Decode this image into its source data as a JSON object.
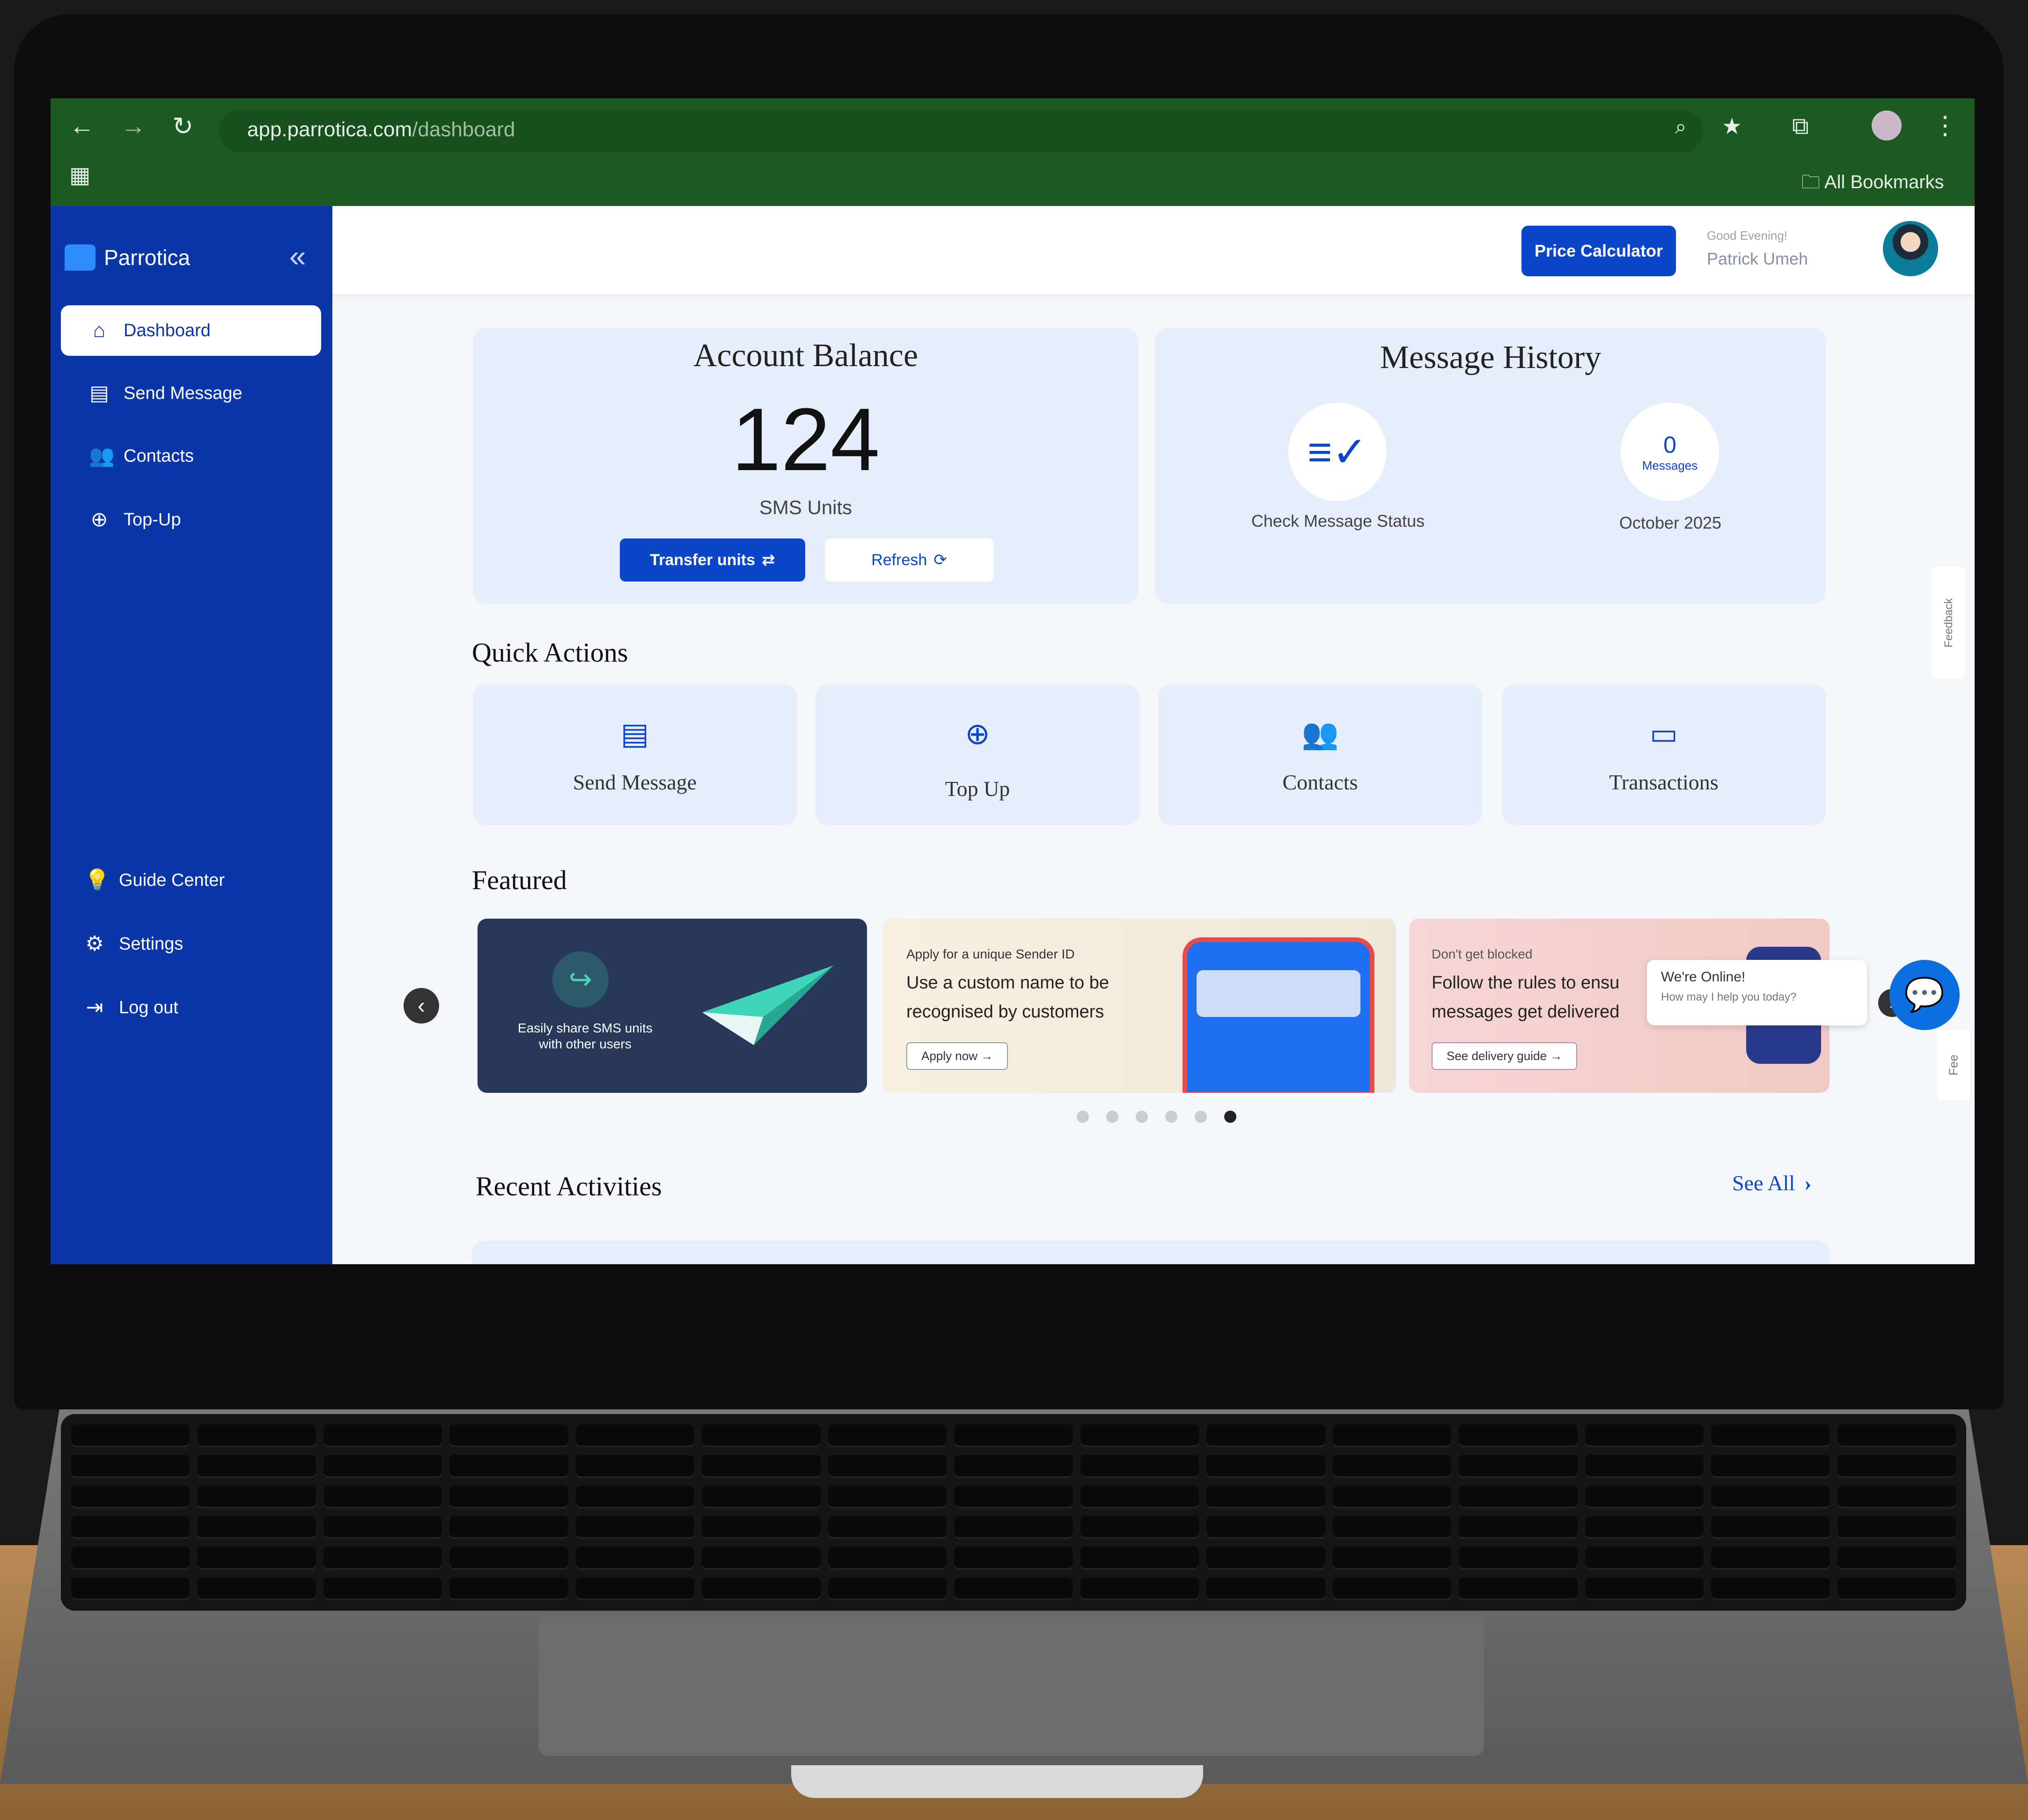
{
  "browser": {
    "url_host": "app.parrotica.com",
    "url_path": "/dashboard",
    "bookmarks_label": "All Bookmarks"
  },
  "sidebar": {
    "brand": "Parrotica",
    "items": [
      {
        "label": "Dashboard",
        "icon": "home-icon",
        "active": true
      },
      {
        "label": "Send Message",
        "icon": "message-icon"
      },
      {
        "label": "Contacts",
        "icon": "contacts-icon"
      },
      {
        "label": "Top-Up",
        "icon": "plus-circle-icon"
      }
    ],
    "bottom_items": [
      {
        "label": "Guide Center",
        "icon": "bulb-icon"
      },
      {
        "label": "Settings",
        "icon": "gear-icon"
      },
      {
        "label": "Log out",
        "icon": "logout-icon"
      }
    ]
  },
  "header": {
    "price_calculator": "Price Calculator",
    "greeting": "Good Evening!",
    "user_name": "Patrick Umeh"
  },
  "account_balance": {
    "title": "Account Balance",
    "value": "124",
    "unit": "SMS Units",
    "transfer_label": "Transfer units",
    "refresh_label": "Refresh"
  },
  "message_history": {
    "title": "Message History",
    "check_status_label": "Check Message Status",
    "count": "0",
    "count_unit": "Messages",
    "period": "October 2025"
  },
  "quick_actions": {
    "title": "Quick Actions",
    "items": [
      {
        "label": "Send Message",
        "icon": "message-icon"
      },
      {
        "label": "Top Up",
        "icon": "plus-circle-icon"
      },
      {
        "label": "Contacts",
        "icon": "contacts-icon"
      },
      {
        "label": "Transactions",
        "icon": "wallet-icon"
      }
    ]
  },
  "featured": {
    "title": "Featured",
    "banner1_text_1": "Easily share SMS units",
    "banner1_text_2": "with other users",
    "banner2_small": "Apply for a unique Sender ID",
    "banner2_heading_1": "Use a custom name to be",
    "banner2_heading_2": "recognised by customers",
    "banner2_button": "Apply now →",
    "banner3_small": "Don't get blocked",
    "banner3_heading_1": "Follow the rules to ensu",
    "banner3_heading_2": "messages get delivered",
    "banner3_button": "See delivery guide →",
    "active_dot": 6,
    "dot_count": 6
  },
  "chat": {
    "online": "We're Online!",
    "prompt": "How may I help you today?"
  },
  "feedback_label": "Feedback",
  "feedback_label_short": "Fee",
  "recent": {
    "title": "Recent Activities",
    "see_all": "See All"
  }
}
